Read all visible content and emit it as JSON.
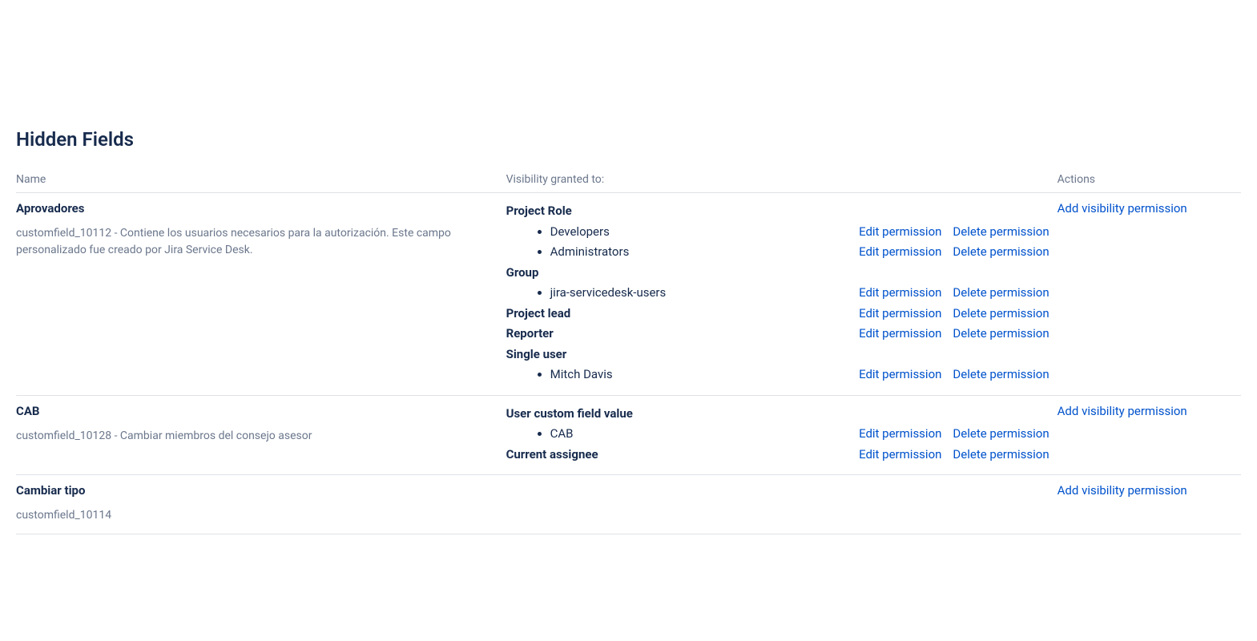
{
  "page_title": "Hidden Fields",
  "columns": {
    "name": "Name",
    "visibility": "Visibility granted to:",
    "actions": "Actions"
  },
  "labels": {
    "edit": "Edit permission",
    "delete": "Delete permission",
    "add": "Add visibility permission"
  },
  "rows": [
    {
      "name": "Aprovadores",
      "desc": "customfield_10112 - Contiene los usuarios necesarios para la autorización. Este campo personalizado fue creado por Jira Service Desk.",
      "visibility": [
        {
          "group_label": "Project Role",
          "items": [
            "Developers",
            "Administrators"
          ],
          "actions_on": "items"
        },
        {
          "group_label": "Group",
          "items": [
            "jira-servicedesk-users"
          ],
          "actions_on": "items"
        },
        {
          "group_label": "Project lead",
          "items": [],
          "actions_on": "label"
        },
        {
          "group_label": "Reporter",
          "items": [],
          "actions_on": "label"
        },
        {
          "group_label": "Single user",
          "items": [
            "Mitch Davis"
          ],
          "actions_on": "items"
        }
      ]
    },
    {
      "name": "CAB",
      "desc": "customfield_10128 - Cambiar miembros del consejo asesor",
      "visibility": [
        {
          "group_label": "User custom field value",
          "items": [
            "CAB"
          ],
          "actions_on": "items"
        },
        {
          "group_label": "Current assignee",
          "items": [],
          "actions_on": "label"
        }
      ]
    },
    {
      "name": "Cambiar tipo",
      "desc": "customfield_10114",
      "visibility": []
    }
  ]
}
